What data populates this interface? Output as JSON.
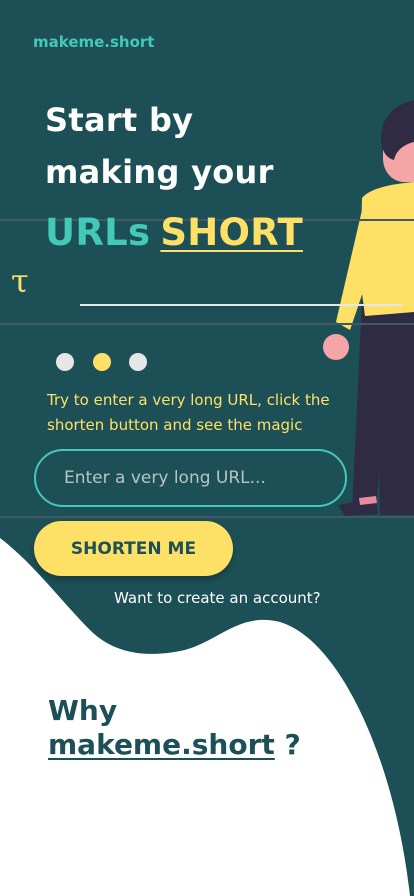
{
  "brand": {
    "logo_text": "makeme.short"
  },
  "hero": {
    "line1": "Start by",
    "line2": "making your",
    "line3_part1": "URLs",
    "line3_part2": "SHORT",
    "glyph": "τ"
  },
  "carousel": {
    "count": 3,
    "active_index": 1
  },
  "tagline": "Try to enter a very long URL, click the shorten button and see the magic",
  "url_input": {
    "placeholder": "Enter a very long URL...",
    "value": ""
  },
  "shorten_button": {
    "label": "SHORTEN ME"
  },
  "account_link": {
    "label": "Want to create an account?"
  },
  "why_section": {
    "prefix": "Why",
    "brand": "makeme.short",
    "suffix": "?"
  },
  "colors": {
    "background_dark": "#1c5056",
    "accent_teal": "#44c9b8",
    "accent_yellow": "#ffe066",
    "white": "#ffffff"
  }
}
